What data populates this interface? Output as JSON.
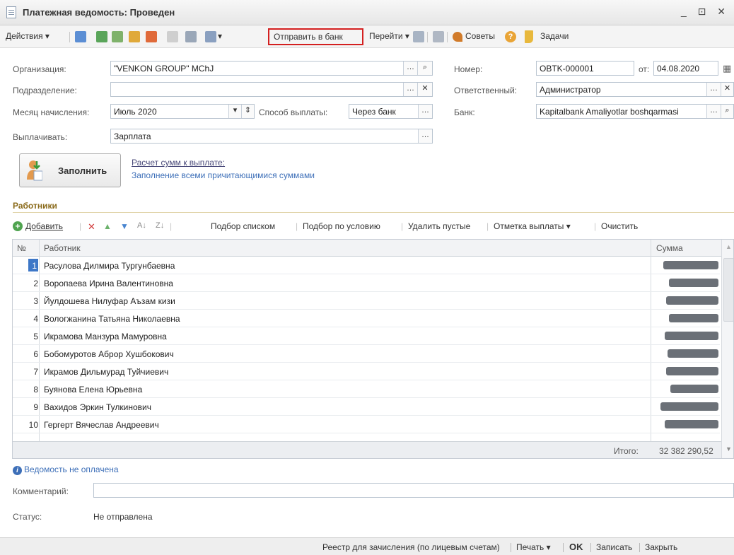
{
  "window": {
    "title": "Платежная ведомость: Проведен",
    "controls": "_ ⊡ ✕"
  },
  "toolbar": {
    "actions": "Действия",
    "send_to_bank": "Отправить в банк",
    "go_to": "Перейти",
    "tips": "Советы",
    "help": "?",
    "tasks": "Задачи"
  },
  "form": {
    "organization_label": "Организация:",
    "organization_value": "\"VENKON GROUP\" MChJ",
    "department_label": "Подразделение:",
    "department_value": "",
    "month_label": "Месяц начисления:",
    "month_value": "Июль 2020",
    "pay_method_label": "Способ выплаты:",
    "pay_method_value": "Через банк",
    "pay_type_label": "Выплачивать:",
    "pay_type_value": "Зарплата",
    "number_label": "Номер:",
    "number_value": "OBTK-000001",
    "date_label": "от:",
    "date_value": "04.08.2020",
    "responsible_label": "Ответственный:",
    "responsible_value": "Администратор",
    "bank_label": "Банк:",
    "bank_value": "Kapitalbank Amaliyotlar boshqarmasi"
  },
  "fill": {
    "button_label": "Заполнить",
    "calc_link": "Расчет сумм к выплате:",
    "calc_desc": "Заполнение всеми причитающимися суммами"
  },
  "employees": {
    "section_title": "Работники",
    "toolbar": {
      "add": "Добавить",
      "pick_list": "Подбор списком",
      "pick_condition": "Подбор по условию",
      "delete_empty": "Удалить пустые",
      "payment_mark": "Отметка выплаты",
      "clear": "Очистить"
    },
    "columns": {
      "num": "№",
      "employee": "Работник",
      "sum": "Сумма"
    },
    "rows": [
      {
        "num": "1",
        "name": "Расулова Дилмира Тургунбаевна"
      },
      {
        "num": "2",
        "name": "Воропаева Ирина Валентиновна"
      },
      {
        "num": "3",
        "name": "Йулдошева Нилуфар Аъзам кизи"
      },
      {
        "num": "4",
        "name": "Вологжанина Татьяна Николаевна"
      },
      {
        "num": "5",
        "name": "Икрамова Манзура Мамуровна"
      },
      {
        "num": "6",
        "name": "Бобомуротов Аброр Хушбокович"
      },
      {
        "num": "7",
        "name": "Икрамов Дильмурад Туйчиевич"
      },
      {
        "num": "8",
        "name": "Буянова Елена Юрьевна"
      },
      {
        "num": "9",
        "name": "Вахидов Эркин Тулкинович"
      },
      {
        "num": "10",
        "name": "Гергерт Вячеслав Андреевич"
      }
    ],
    "total_label": "Итого:",
    "total_value": "32 382 290,52"
  },
  "info": {
    "not_paid": "Ведомость не оплачена",
    "comment_label": "Комментарий:",
    "comment_value": "",
    "status_label": "Статус:",
    "status_value": "Не отправлена"
  },
  "bottom": {
    "registry": "Реестр для зачисления (по лицевым счетам)",
    "print": "Печать",
    "ok": "OK",
    "save": "Записать",
    "close": "Закрыть"
  },
  "colors": {
    "highlight_border": "#d42020",
    "selection": "#3d77c7",
    "link": "#3d6fb8",
    "section_title": "#8a6a1a"
  }
}
